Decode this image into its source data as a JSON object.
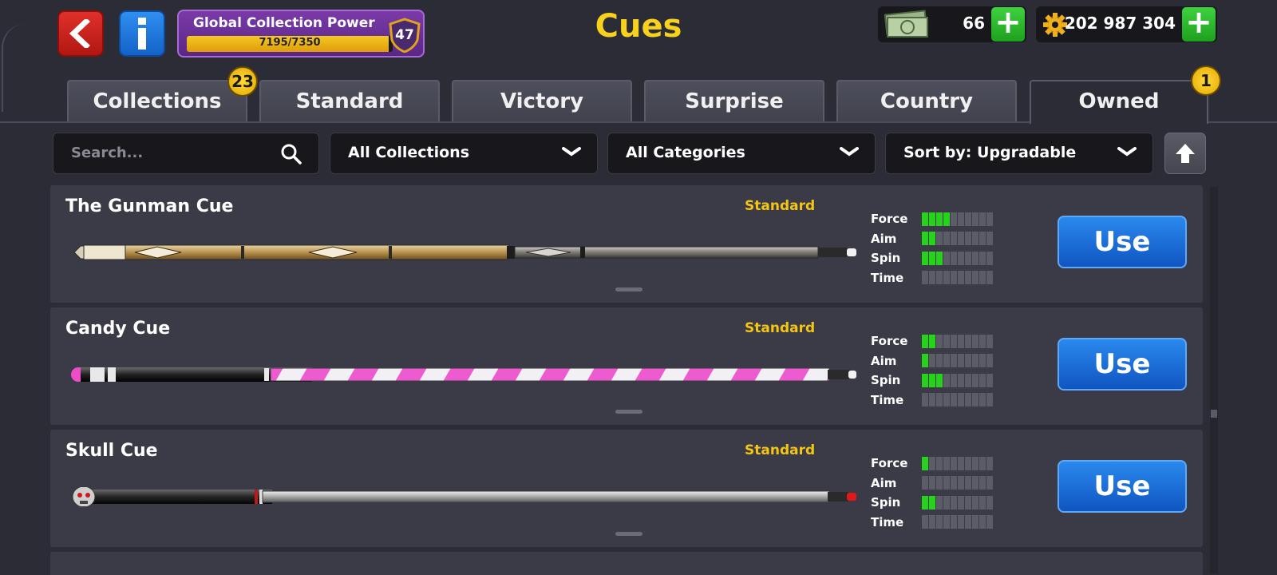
{
  "header": {
    "title": "Cues",
    "power_label": "Global Collection Power",
    "power_text": "7195/7350",
    "power_fraction": 0.979,
    "level": "47"
  },
  "currency": {
    "cash": "66",
    "coins": "202 987 304"
  },
  "tabs": [
    {
      "label": "Collections",
      "badge": "23"
    },
    {
      "label": "Standard"
    },
    {
      "label": "Victory"
    },
    {
      "label": "Surprise"
    },
    {
      "label": "Country"
    },
    {
      "label": "Owned",
      "badge": "1",
      "active": true
    }
  ],
  "filters": {
    "search_placeholder": "Search...",
    "collections": "All Collections",
    "categories": "All Categories",
    "sort": "Sort by: Upgradable"
  },
  "stat_labels": [
    "Force",
    "Aim",
    "Spin",
    "Time"
  ],
  "cues": [
    {
      "name": "The Gunman Cue",
      "category": "Standard",
      "stats": [
        4,
        2,
        3,
        0
      ],
      "use_label": "Use"
    },
    {
      "name": "Candy Cue",
      "category": "Standard",
      "stats": [
        2,
        1,
        3,
        0
      ],
      "use_label": "Use"
    },
    {
      "name": "Skull Cue",
      "category": "Standard",
      "stats": [
        1,
        0,
        2,
        0
      ],
      "use_label": "Use"
    }
  ],
  "stat_max": 10,
  "colors": {
    "accent_yellow": "#f7d11b",
    "stat_on": "#26d21c",
    "use_button": "#1a6fd8",
    "panel": "#3a3b46"
  }
}
